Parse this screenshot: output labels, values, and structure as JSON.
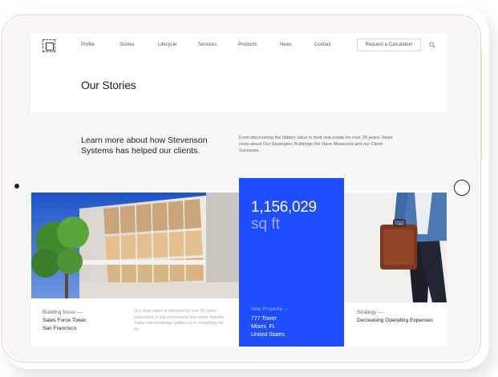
{
  "nav": {
    "items": [
      "Profile",
      "Stories",
      "Lifecycle",
      "Services",
      "Products",
      "News",
      "Contact"
    ],
    "cta_label": "Request a Calculation"
  },
  "page_title": "Our Stories",
  "lead_text": "Learn more about how Stevenson Systems has helped our clients.",
  "intro_text": "From discovering the hidden value in their real estate for over 30 years. Read more about Our Strategies; Buildings We Have Measured and our Client Sucesses.",
  "stat": {
    "number": "1,156,029",
    "unit": "sq ft",
    "label": "New Property —",
    "lines": [
      "777 Tower",
      "Miami, FL",
      "United States"
    ]
  },
  "building_card": {
    "label": "Building focus —",
    "lines": [
      "Sales Force Tower,",
      "San Francisco"
    ],
    "description": "Our clear vision is informed by over 50 years experience in the commercial real estate industry. Today our knowledge guides us in everything we do."
  },
  "strategy_card": {
    "label": "Strategy —",
    "value": "Decreasing Operating Expenses"
  },
  "colors": {
    "accent_blue": "#1e4dff",
    "band_gray": "#f7f7f7",
    "ipad_trim": "#e6d6bf"
  }
}
